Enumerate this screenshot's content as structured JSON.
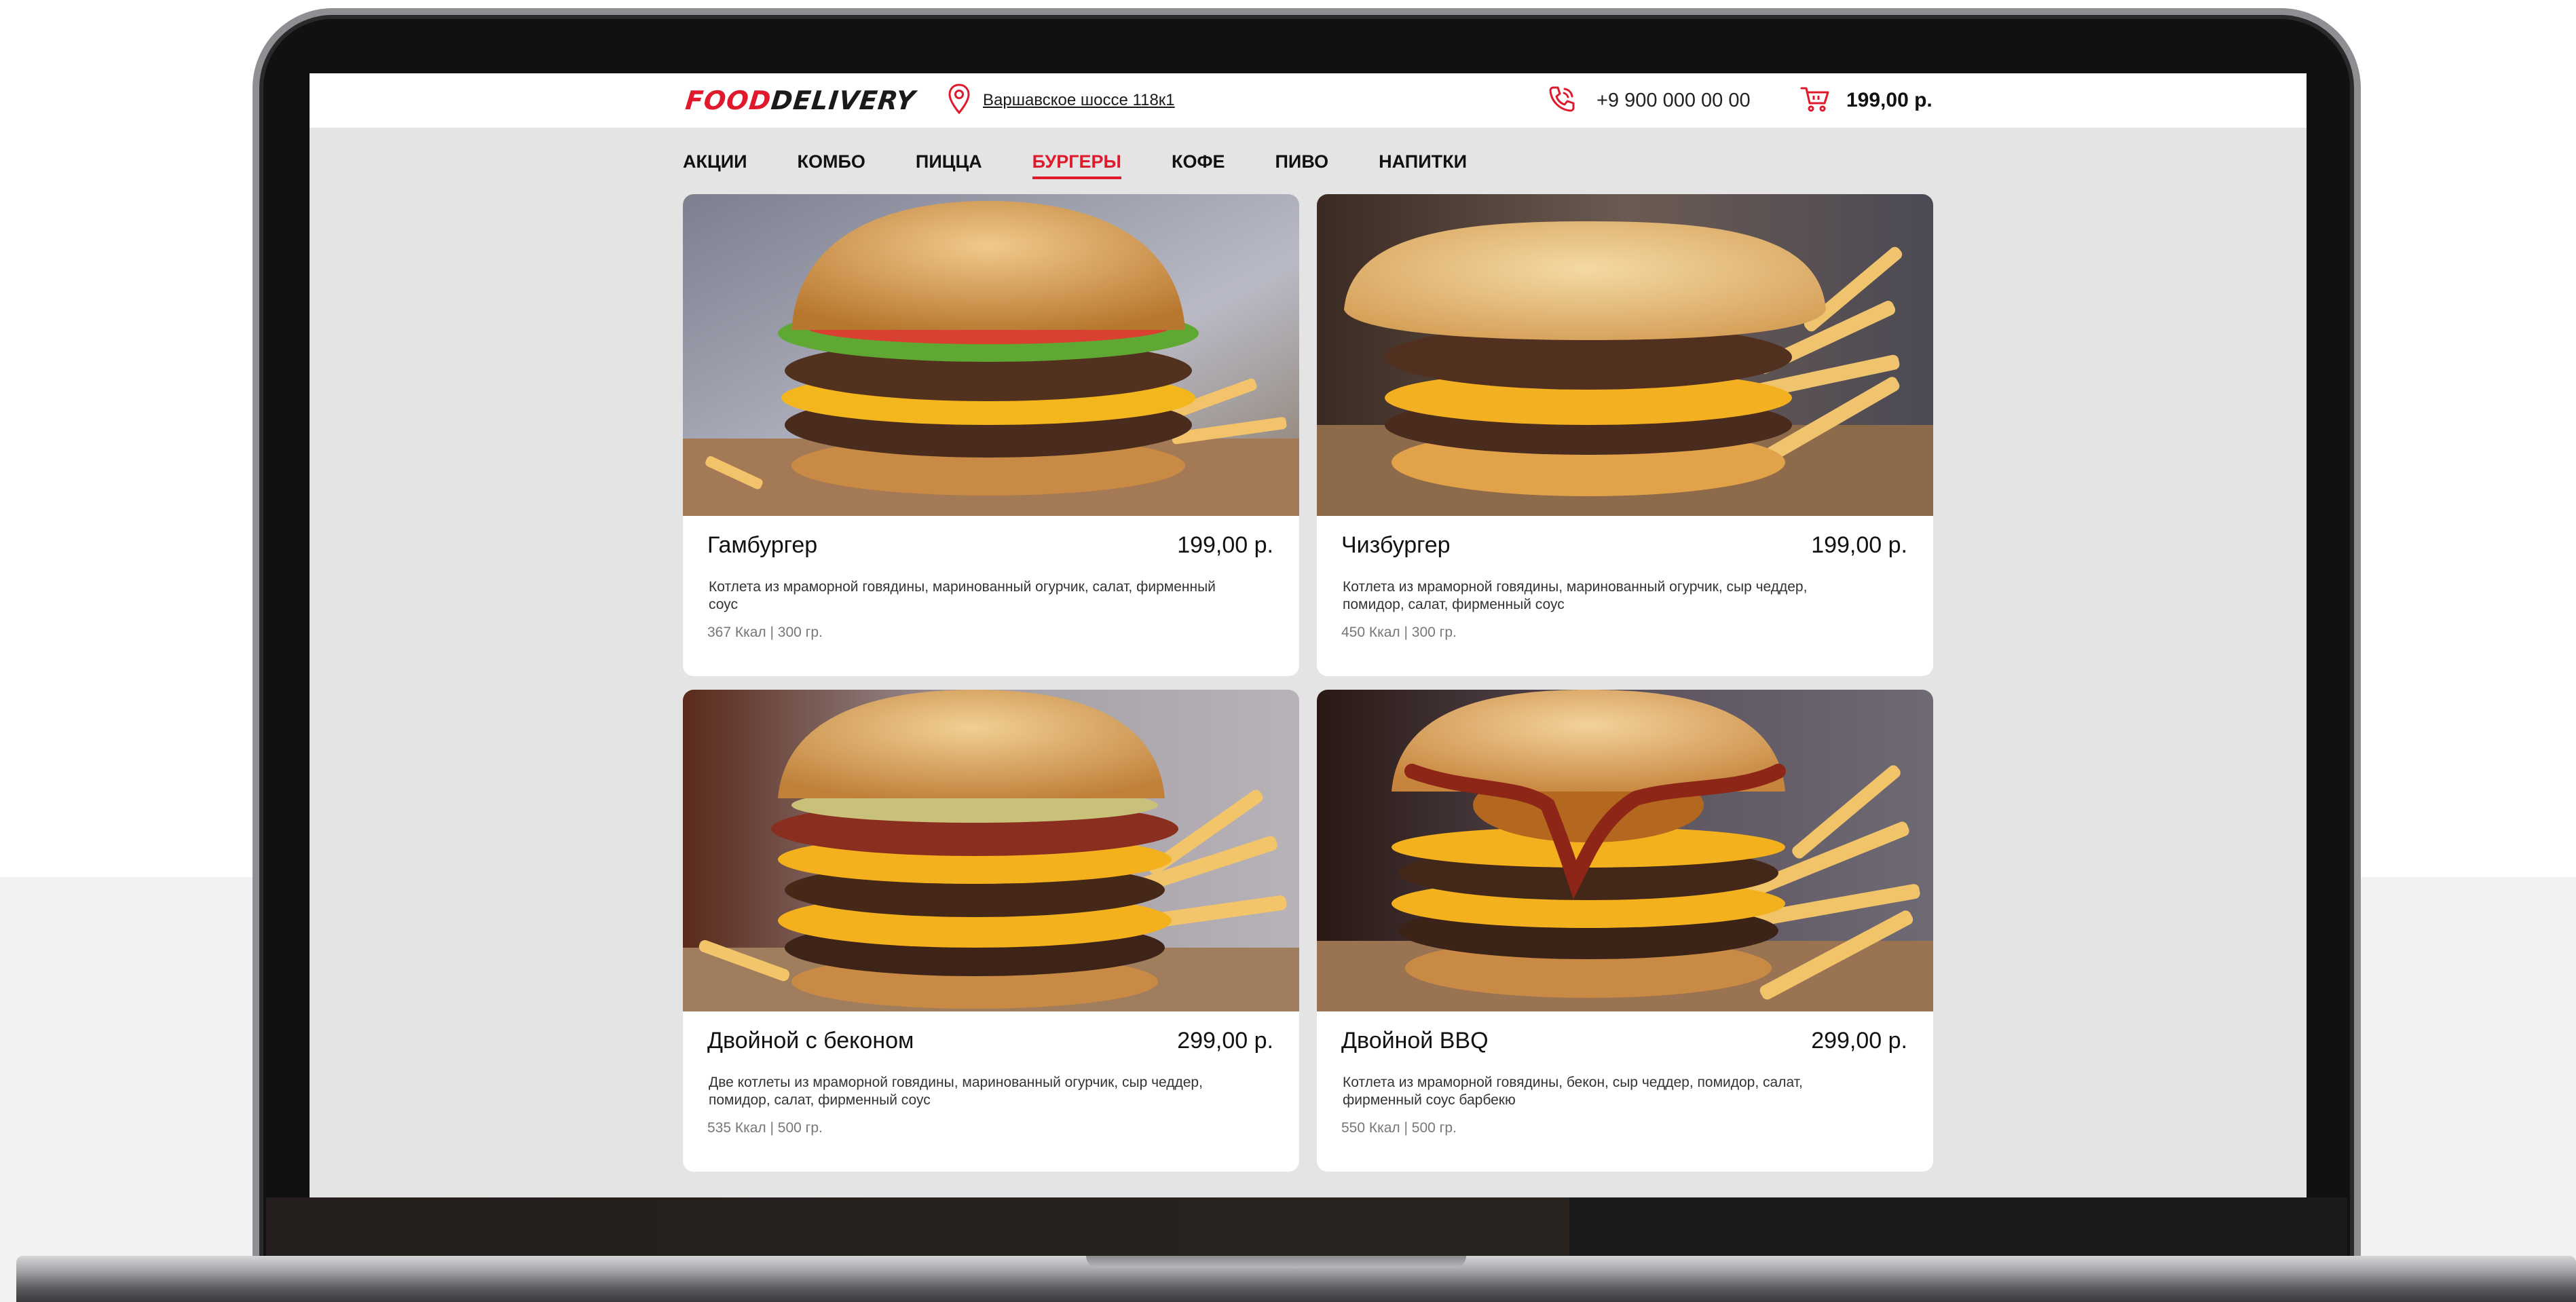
{
  "header": {
    "logo_food": "FOOD",
    "logo_delivery": "DELIVERY",
    "address": "Варшавское шоссе 118к1",
    "phone": "+9 900 000 00 00",
    "cart_total": "199,00 р."
  },
  "nav": {
    "items": [
      {
        "label": "АКЦИИ",
        "active": false
      },
      {
        "label": "КОМБО",
        "active": false
      },
      {
        "label": "ПИЦЦА",
        "active": false
      },
      {
        "label": "БУРГЕРЫ",
        "active": true
      },
      {
        "label": "КОФЕ",
        "active": false
      },
      {
        "label": "ПИВО",
        "active": false
      },
      {
        "label": "НАПИТКИ",
        "active": false
      }
    ]
  },
  "products": [
    {
      "title": "Гамбургер",
      "price": "199,00 р.",
      "description": "Котлета из мраморной говядины, маринованный огурчик, салат, фирменный соус",
      "meta": "367 Ккал  |  300 гр."
    },
    {
      "title": "Чизбургер",
      "price": "199,00 р.",
      "description": "Котлета из мраморной говядины, маринованный огурчик, сыр чеддер, помидор, салат, фирменный соус",
      "meta": "450 Ккал  |  300 гр."
    },
    {
      "title": "Двойной с беконом",
      "price": "299,00 р.",
      "description": "Две котлеты из мраморной говядины, маринованный огурчик, сыр чеддер, помидор, салат, фирменный соус",
      "meta": "535 Ккал  |  500 гр."
    },
    {
      "title": "Двойной BBQ",
      "price": "299,00 р.",
      "description": "Котлета из мраморной говядины, бекон, сыр чеддер, помидор, салат, фирменный соус барбекю",
      "meta": "550 Ккал  |  500 гр."
    }
  ],
  "colors": {
    "accent": "#e0192d",
    "screen_bg": "#e4e4e4",
    "card_bg": "#ffffff"
  },
  "icons": {
    "address": "map-pin-icon",
    "phone": "phone-icon",
    "cart": "cart-icon"
  }
}
